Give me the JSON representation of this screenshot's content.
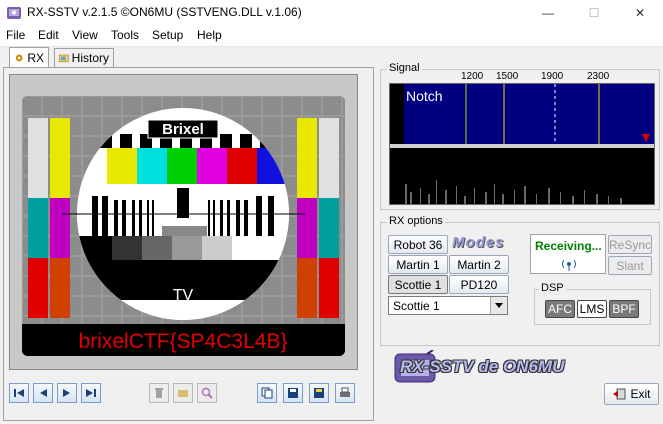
{
  "window": {
    "title": "RX-SSTV v.2.1.5 ©ON6MU (SSTVENG.DLL v.1.06)",
    "minimize": "—",
    "maximize": "☐",
    "close": "✕"
  },
  "menu": [
    "File",
    "Edit",
    "View",
    "Tools",
    "Setup",
    "Help"
  ],
  "tabs": [
    {
      "label": "RX",
      "icon": "gear-icon"
    },
    {
      "label": "History",
      "icon": "folder-image-icon"
    }
  ],
  "image": {
    "brand": "Brixel",
    "channel": "TV",
    "message": "brixelCTF{SP4C3L4B}"
  },
  "signal": {
    "label": "Signal",
    "scale": [
      "1200",
      "1500",
      "1900",
      "2300"
    ],
    "notch": "Notch"
  },
  "rx_options": {
    "label": "RX options",
    "modes_logo": "Modes",
    "buttons": [
      "Robot 36",
      "Martin 1",
      "Martin 2",
      "Scottie 1",
      "PD120"
    ],
    "selected_mode": "Scottie 1",
    "status": "Receiving...",
    "resync": "ReSync",
    "slant": "Slant"
  },
  "dsp": {
    "label": "DSP",
    "afc": "AFC",
    "lms": "LMS",
    "bpf": "BPF"
  },
  "logo_text": "RX-SSTV de ON6MU",
  "exit_label": "Exit",
  "colors": {
    "accent_green": "#008000",
    "flag_red": "#e60000",
    "waterfall_bg": "#000080"
  }
}
